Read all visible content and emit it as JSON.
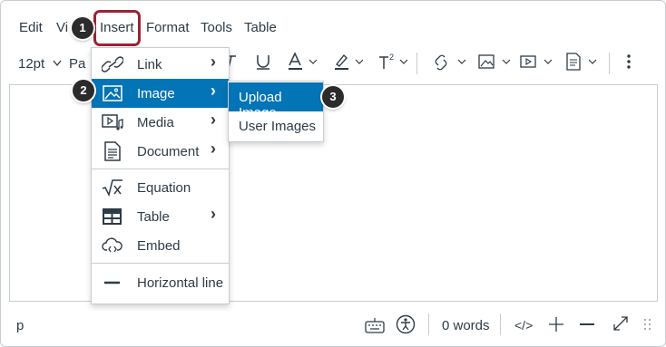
{
  "menubar": {
    "edit": "Edit",
    "view": "Vi",
    "insert": "Insert",
    "format": "Format",
    "tools": "Tools",
    "table": "Table"
  },
  "toolbar": {
    "font_size": "12pt",
    "paragraph": "Pa"
  },
  "insert_menu": {
    "items": [
      {
        "label": "Link",
        "icon": "link-icon",
        "has_submenu": true
      },
      {
        "label": "Image",
        "icon": "image-icon",
        "has_submenu": true,
        "active": true
      },
      {
        "label": "Media",
        "icon": "media-icon",
        "has_submenu": true
      },
      {
        "label": "Document",
        "icon": "document-icon",
        "has_submenu": true
      },
      {
        "label": "Equation",
        "icon": "equation-icon",
        "has_submenu": false
      },
      {
        "label": "Table",
        "icon": "table-icon",
        "has_submenu": true
      },
      {
        "label": "Embed",
        "icon": "embed-icon",
        "has_submenu": false
      },
      {
        "label": "Horizontal line",
        "icon": "horizontal-line-icon",
        "has_submenu": false
      }
    ],
    "arrow": "›"
  },
  "image_submenu": {
    "items": [
      {
        "label": "Upload Image",
        "active": true
      },
      {
        "label": "User Images"
      }
    ]
  },
  "callouts": [
    "1",
    "2",
    "3"
  ],
  "statusbar": {
    "element_path": "p",
    "word_count": "0 words",
    "html_toggle": "</>"
  },
  "colors": {
    "accent": "#0374b5",
    "highlight_border": "#9d2235",
    "text": "#2d3b45",
    "border": "#c7cdd1"
  }
}
